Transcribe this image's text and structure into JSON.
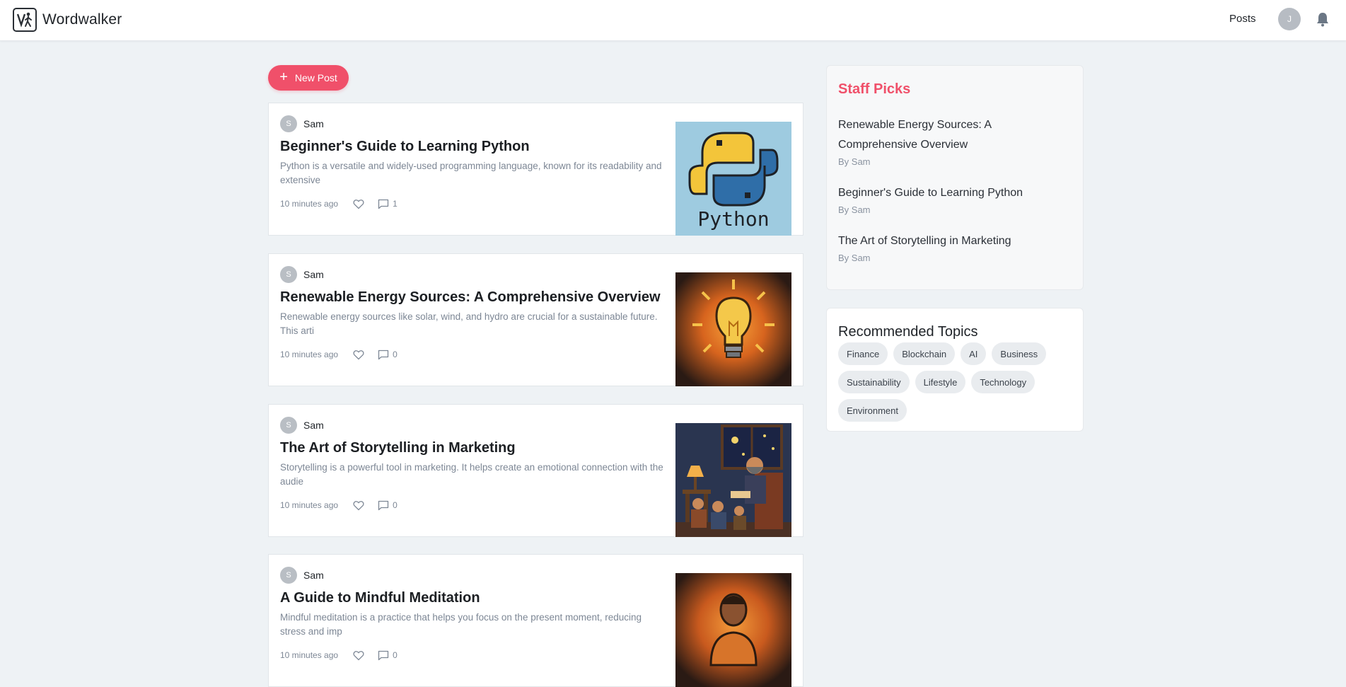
{
  "header": {
    "brand_name": "Wordwalker",
    "nav_posts": "Posts",
    "user_initial": "J"
  },
  "actions": {
    "new_post_label": "New Post"
  },
  "posts": [
    {
      "author_initial": "S",
      "author": "Sam",
      "title": "Beginner's Guide to Learning Python",
      "excerpt": "Python is a versatile and widely-used programming language, known for its readability and extensive",
      "time": "10 minutes ago",
      "comments": "1",
      "thumb_caption": "Python"
    },
    {
      "author_initial": "S",
      "author": "Sam",
      "title": "Renewable Energy Sources: A Comprehensive Overview",
      "excerpt": "Renewable energy sources like solar, wind, and hydro are crucial for a sustainable future. This arti",
      "time": "10 minutes ago",
      "comments": "0"
    },
    {
      "author_initial": "S",
      "author": "Sam",
      "title": "The Art of Storytelling in Marketing",
      "excerpt": "Storytelling is a powerful tool in marketing. It helps create an emotional connection with the audie",
      "time": "10 minutes ago",
      "comments": "0"
    },
    {
      "author_initial": "S",
      "author": "Sam",
      "title": "A Guide to Mindful Meditation",
      "excerpt": "Mindful meditation is a practice that helps you focus on the present moment, reducing stress and imp",
      "time": "10 minutes ago",
      "comments": "0"
    }
  ],
  "staff_picks": {
    "title": "Staff Picks",
    "items": [
      {
        "title": "Renewable Energy Sources: A Comprehensive Overview",
        "author": "By Sam"
      },
      {
        "title": "Beginner's Guide to Learning Python",
        "author": "By Sam"
      },
      {
        "title": "The Art of Storytelling in Marketing",
        "author": "By Sam"
      }
    ]
  },
  "topics": {
    "title": "Recommended Topics",
    "items": [
      "Finance",
      "Blockchain",
      "AI",
      "Business",
      "Sustainability",
      "Lifestyle",
      "Technology",
      "Environment"
    ]
  },
  "colors": {
    "accent": "#f0506a",
    "background": "#eef2f5",
    "muted_text": "#7d8795"
  }
}
